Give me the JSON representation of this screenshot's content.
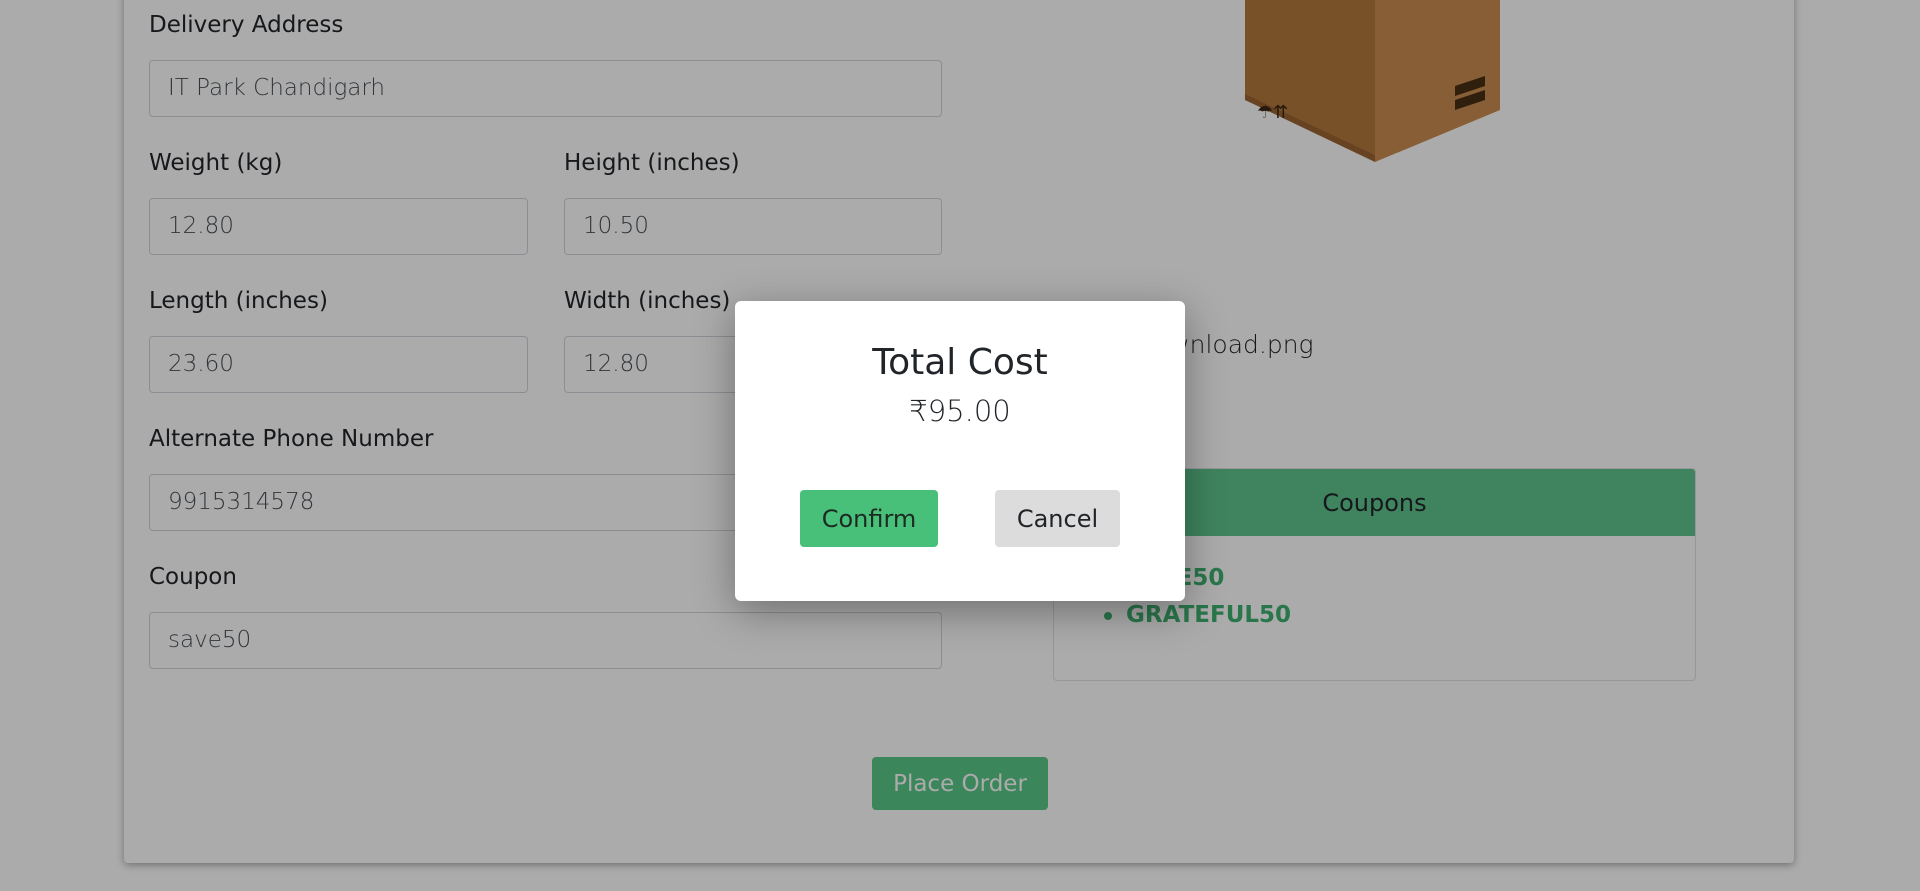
{
  "form": {
    "delivery_address": {
      "label": "Delivery Address",
      "value": "IT Park Chandigarh"
    },
    "weight": {
      "label": "Weight (kg)",
      "value": "12.80"
    },
    "height": {
      "label": "Height (inches)",
      "value": "10.50"
    },
    "length": {
      "label": "Length (inches)",
      "value": "23.60"
    },
    "width": {
      "label": "Width (inches)",
      "value": "12.80"
    },
    "alt_phone": {
      "label": "Alternate Phone Number",
      "value": "9915314578"
    },
    "coupon": {
      "label": "Coupon",
      "value": "save50"
    }
  },
  "upload": {
    "filename": "download.png"
  },
  "coupons_panel": {
    "header": "Coupons",
    "items": [
      "SAVE50",
      "GRATEFUL50"
    ]
  },
  "place_order_label": "Place Order",
  "modal": {
    "title": "Total Cost",
    "amount": "₹95.00",
    "confirm_label": "Confirm",
    "cancel_label": "Cancel"
  },
  "colors": {
    "accent_green": "#48c07a",
    "coupon_header": "#5fc58c",
    "coupon_text": "#3fb170",
    "cancel_gray": "#dcdcdc"
  },
  "icons": [
    "package-box-icon"
  ]
}
